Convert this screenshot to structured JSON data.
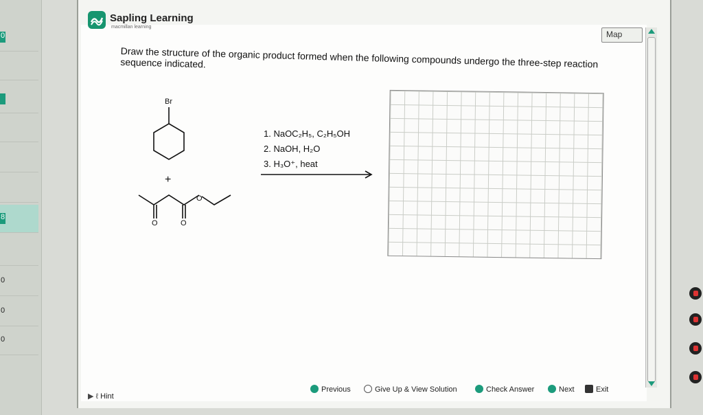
{
  "brand": {
    "name": "Sapling Learning",
    "sub": "macmillan learning"
  },
  "map_label": "Map",
  "question": "Draw the structure of the organic product formed when the following compounds undergo the three-step reaction sequence indicated.",
  "molecule_labels": {
    "br": "Br",
    "plus": "+",
    "o_ester": "O",
    "o_left": "O",
    "o_right": "O"
  },
  "reagents": [
    "1. NaOC₂H₅, C₂H₅OH",
    "2. NaOH, H₂O",
    "3. H₃O⁺, heat"
  ],
  "toolbar": {
    "hint": "Hint",
    "previous": "Previous",
    "give_up": "Give Up & View Solution",
    "check": "Check Answer",
    "next": "Next",
    "exit": "Exit"
  },
  "left_rail": [
    "0",
    "",
    "",
    "",
    "8",
    "",
    "",
    "0",
    "0",
    "0"
  ],
  "colors": {
    "accent": "#1c9b7c",
    "panel": "#fdfdfc"
  }
}
